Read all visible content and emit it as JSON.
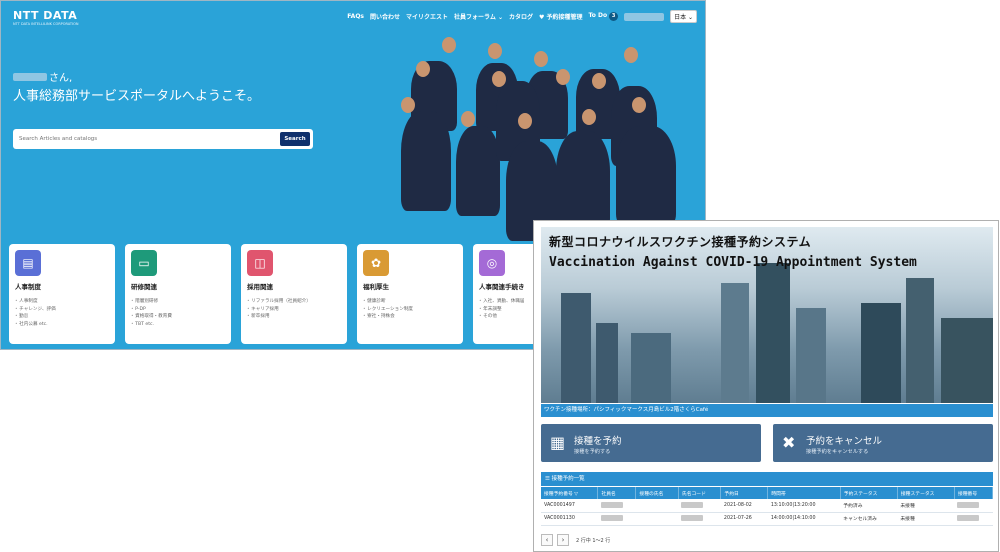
{
  "portal": {
    "logo": "NTT DATA",
    "logo_sub": "NTT DATA INTELLILINK CORPORATION",
    "nav": [
      "FAQs",
      "問い合わせ",
      "マイリクエスト",
      "社員フォーラム ⌄",
      "カタログ",
      "♥ 予約接種管理",
      "To Do"
    ],
    "todo_count": "3",
    "language": "日本 ⌄",
    "greeting_suffix": "さん,",
    "welcome": "人事総務部サービスポータルへようこそ。",
    "search_placeholder": "Search Articles and catalogs",
    "search_button": "Search",
    "cards": [
      {
        "title": "人事制度",
        "icon": "clipboard-icon",
        "color": "#5a6fd6",
        "items": [
          "人事制度",
          "チャレンジ、評価",
          "勤怠",
          "社内公募 etc."
        ]
      },
      {
        "title": "研修関連",
        "icon": "monitor-icon",
        "color": "#1e9a7a",
        "items": [
          "階層別研修",
          "P-DP",
          "資格取得・教育費",
          "TBT etc."
        ]
      },
      {
        "title": "採用関連",
        "icon": "id-card-icon",
        "color": "#e0556e",
        "items": [
          "リファラル採用（社員紹介）",
          "キャリア採用",
          "新卒採用"
        ]
      },
      {
        "title": "福利厚生",
        "icon": "benefits-icon",
        "color": "#d99a34",
        "items": [
          "健康診断",
          "レクリエーション制度",
          "寮社・持株会"
        ]
      },
      {
        "title": "人事関連手続き",
        "icon": "process-icon",
        "color": "#a46ad6",
        "items": [
          "入社、異動、休職届",
          "年末調整",
          "その他"
        ]
      }
    ]
  },
  "vax": {
    "title_jp": "新型コロナウイルスワクチン接種予約システム",
    "title_en": "Vaccination Against COVID-19 Appointment System",
    "venue": "ワクチン接種場所：パシフィックマークス月島ビル2階さくらCafé",
    "actions": [
      {
        "title": "接種を予約",
        "subtitle": "接種を予約する",
        "icon": "calendar-icon"
      },
      {
        "title": "予約をキャンセル",
        "subtitle": "接種予約をキャンセルする",
        "icon": "close-icon"
      }
    ],
    "list_title": "☰ 接種予約一覧",
    "columns": [
      "接種予約番号 ▽",
      "社員名",
      "接種の氏名",
      "氏名コード",
      "予約日",
      "時間帯",
      "予約ステータス",
      "接種ステータス",
      "接種番号"
    ],
    "rows": [
      {
        "id": "VAC0001497",
        "date": "2021-08-02",
        "time": "13:10:00|13:20:00",
        "res_status": "予約済み",
        "vax_status": "未接種"
      },
      {
        "id": "VAC0001130",
        "date": "2021-07-26",
        "time": "14:00:00|14:10:00",
        "res_status": "キャンセル済み",
        "vax_status": "未接種"
      }
    ],
    "pager_prev": "‹",
    "pager_next": "›",
    "pager_text": "2 行中 1～2 行"
  }
}
